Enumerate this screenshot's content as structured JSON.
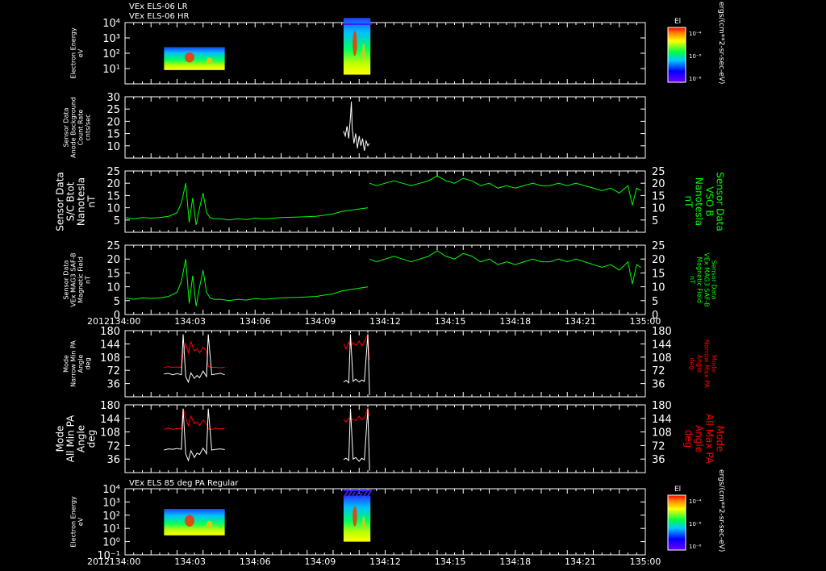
{
  "headers": {
    "top_line1": "VEx ELS-06 LR",
    "top_line2": "VEx ELS-06 HR",
    "bottom": "VEx ELS 85 deg PA Regular"
  },
  "time_axis": {
    "year": "2012",
    "ticks": [
      "134:00",
      "134:03",
      "134:06",
      "134:09",
      "134:12",
      "134:15",
      "134:18",
      "134:21",
      "135:00"
    ]
  },
  "colorbars": {
    "label": "El",
    "ticks": [
      "10⁻⁴",
      "10⁻⁶",
      "10⁻⁸"
    ],
    "unit": "ergs/(cm**2-sr-sec-eV)"
  },
  "colors": {
    "background": "#000000",
    "frame": "#ffffff",
    "white_trace": "#ffffff",
    "green_trace": "#00ff00",
    "red_trace": "#ff0000"
  },
  "chart_data": [
    {
      "type": "heatmap",
      "panel": "electron-energy-top",
      "ylabel": [
        "Electron Energy",
        "eV"
      ],
      "yscale": "log",
      "ylim": [
        1,
        10000
      ],
      "y_ticks": [
        "10⁴",
        "10³",
        "10²",
        "10¹"
      ],
      "x_range": [
        0,
        60
      ],
      "blocks": [
        {
          "x_start": 4.5,
          "x_end": 11.5,
          "y_low": 8,
          "y_high": 250
        },
        {
          "x_start": 25.2,
          "x_end": 28.3,
          "y_low": 4,
          "y_high": 20000
        }
      ]
    },
    {
      "type": "line",
      "panel": "anode-background",
      "ylabel": [
        "Sensor Data",
        "Anode Background",
        "Count Rate",
        "cnts/sec"
      ],
      "ylim": [
        5,
        30
      ],
      "y_ticks": [
        30,
        25,
        20,
        15,
        10
      ],
      "series": [
        {
          "color": "white",
          "x": [
            25.2,
            25.4,
            25.6,
            25.8,
            26.0,
            26.1,
            26.2,
            26.4,
            26.6,
            26.8,
            27.0,
            27.2,
            27.4,
            27.6,
            27.8,
            28.0,
            28.2
          ],
          "y": [
            16,
            14,
            18,
            13,
            22,
            28,
            17,
            11,
            15,
            9,
            14,
            10,
            13,
            8,
            12,
            10,
            11
          ]
        }
      ]
    },
    {
      "type": "line",
      "panel": "bmag-sc",
      "ylabel": [
        "Sensor Data",
        "S/C Btot",
        "Nanotesla",
        "nT"
      ],
      "ylabel_right": [
        "Sensor Data",
        "VSO B",
        "Nanotesla",
        "nT"
      ],
      "ylim": [
        0,
        25
      ],
      "y_ticks": [
        25,
        20,
        15,
        10,
        5
      ],
      "series": [
        {
          "color": "green",
          "x": [
            0,
            1,
            2,
            3,
            4,
            5,
            6,
            6.5,
            7,
            7.4,
            7.8,
            8.2,
            8.6,
            9,
            9.4,
            9.8,
            10.2,
            11,
            12,
            13,
            14,
            15,
            16,
            18,
            20,
            22,
            23,
            24,
            25,
            26,
            27,
            28
          ],
          "y": [
            6,
            5.5,
            6,
            5.8,
            6,
            6.5,
            8,
            12,
            20,
            4,
            14,
            3,
            10,
            16,
            8,
            6,
            5.5,
            5.5,
            5,
            5.5,
            5.2,
            5.8,
            5.5,
            6,
            6.2,
            6.5,
            7,
            7.5,
            8.5,
            9,
            9.5,
            10
          ]
        },
        {
          "color": "green",
          "x": [
            28.2,
            29,
            30,
            31,
            32,
            33,
            34,
            35,
            36,
            37,
            38,
            39,
            40,
            41,
            42,
            43,
            44,
            45,
            46,
            47,
            48,
            49,
            50,
            51,
            52,
            53,
            54,
            55,
            56,
            57,
            58,
            58.5,
            59,
            59.5
          ],
          "y": [
            20,
            19,
            20,
            21,
            20,
            19,
            20,
            21,
            23,
            21,
            20,
            22,
            21,
            19,
            20,
            18,
            19,
            18,
            19,
            20,
            19,
            19,
            20,
            19,
            20,
            19,
            18,
            17,
            18,
            16,
            19,
            11,
            18,
            17
          ]
        }
      ]
    },
    {
      "type": "line",
      "panel": "bmag-saf",
      "ylabel": [
        "Sensor Data",
        "VEx MAG3 SAF-B",
        "Magnetic Field",
        "nT"
      ],
      "ylabel_right": [
        "Sensor Data",
        "VEx MAG3 SAF-B",
        "Magnetic Field",
        "nT"
      ],
      "ylim": [
        0,
        25
      ],
      "y_ticks": [
        25,
        20,
        15,
        10,
        5,
        0
      ],
      "series": [
        {
          "color": "green",
          "x": [
            0,
            1,
            2,
            3,
            4,
            5,
            6,
            6.5,
            7,
            7.4,
            7.8,
            8.2,
            8.6,
            9,
            9.4,
            9.8,
            10.2,
            11,
            12,
            13,
            14,
            15,
            16,
            18,
            20,
            22,
            23,
            24,
            25,
            26,
            27,
            28
          ],
          "y": [
            6,
            5.5,
            6,
            5.8,
            6,
            6.5,
            8,
            12,
            20,
            4,
            14,
            3,
            10,
            16,
            8,
            6,
            5.5,
            5.5,
            5,
            5.5,
            5.2,
            5.8,
            5.5,
            6,
            6.2,
            6.5,
            7,
            7.5,
            8.5,
            9,
            9.5,
            10
          ]
        },
        {
          "color": "green",
          "x": [
            28.2,
            29,
            30,
            31,
            32,
            33,
            34,
            35,
            36,
            37,
            38,
            39,
            40,
            41,
            42,
            43,
            44,
            45,
            46,
            47,
            48,
            49,
            50,
            51,
            52,
            53,
            54,
            55,
            56,
            57,
            58,
            58.5,
            59,
            59.5
          ],
          "y": [
            20,
            19,
            20,
            21,
            20,
            19,
            20,
            21,
            23,
            21,
            20,
            22,
            21,
            19,
            20,
            18,
            19,
            18,
            19,
            20,
            19,
            19,
            20,
            19,
            20,
            19,
            18,
            17,
            18,
            16,
            19,
            11,
            18,
            17
          ]
        }
      ]
    },
    {
      "type": "line",
      "panel": "pa-narrow",
      "ylabel": [
        "Mode",
        "Narrow Min PA",
        "Angle",
        "deg"
      ],
      "ylabel_right": [
        "Mode",
        "Narrow Max PA",
        "Angle",
        "deg"
      ],
      "ylim": [
        0,
        180
      ],
      "y_ticks": [
        180,
        144,
        108,
        72,
        36
      ],
      "series": [
        {
          "color": "red",
          "x": [
            4.5,
            5,
            5.5,
            6,
            6.5,
            6.7,
            7,
            7.3,
            7.6,
            8,
            8.3,
            8.6,
            9,
            9.4,
            9.6,
            10,
            10.5,
            11,
            11.5
          ],
          "y": [
            80,
            82,
            80,
            81,
            80,
            118,
            145,
            120,
            150,
            125,
            130,
            120,
            135,
            125,
            82,
            80,
            80,
            79,
            80
          ]
        },
        {
          "color": "white",
          "x": [
            4.5,
            5,
            5.5,
            6,
            6.5,
            6.7,
            7,
            7.3,
            7.6,
            8,
            8.3,
            8.6,
            9,
            9.4,
            9.6,
            10,
            10.5,
            11,
            11.5
          ],
          "y": [
            62,
            64,
            60,
            63,
            60,
            170,
            55,
            40,
            65,
            50,
            58,
            52,
            70,
            55,
            170,
            60,
            62,
            64,
            60
          ]
        },
        {
          "color": "red",
          "x": [
            25.2,
            25.5,
            25.8,
            26,
            26.3,
            26.6,
            27,
            27.3,
            27.6,
            28,
            28.2
          ],
          "y": [
            145,
            130,
            150,
            135,
            148,
            140,
            152,
            138,
            150,
            170,
            100
          ]
        },
        {
          "color": "white",
          "x": [
            25.2,
            25.5,
            25.8,
            26,
            26.3,
            26.6,
            27,
            27.3,
            27.6,
            28,
            28.2
          ],
          "y": [
            40,
            45,
            38,
            170,
            42,
            48,
            40,
            46,
            42,
            170,
            5
          ]
        }
      ]
    },
    {
      "type": "line",
      "panel": "pa-all",
      "ylabel": [
        "Mode",
        "All Min PA",
        "Angle",
        "deg"
      ],
      "ylabel_right": [
        "Mode",
        "All Max PA",
        "Angle",
        "deg"
      ],
      "ylim": [
        0,
        180
      ],
      "y_ticks": [
        180,
        144,
        108,
        72,
        36
      ],
      "series": [
        {
          "color": "red",
          "x": [
            4.5,
            5,
            5.5,
            6,
            6.5,
            6.7,
            7,
            7.3,
            7.6,
            8,
            8.3,
            8.6,
            9,
            9.4,
            9.6,
            10,
            10.5,
            11,
            11.5
          ],
          "y": [
            115,
            118,
            115,
            117,
            116,
            170,
            145,
            125,
            150,
            130,
            135,
            125,
            140,
            130,
            116,
            115,
            118,
            116,
            117
          ]
        },
        {
          "color": "white",
          "x": [
            4.5,
            5,
            5.5,
            6,
            6.5,
            6.7,
            7,
            7.3,
            7.6,
            8,
            8.3,
            8.6,
            9,
            9.4,
            9.6,
            10,
            10.5,
            11,
            11.5
          ],
          "y": [
            60,
            63,
            62,
            64,
            62,
            170,
            50,
            32,
            58,
            40,
            52,
            48,
            65,
            50,
            170,
            60,
            62,
            63,
            61
          ]
        },
        {
          "color": "red",
          "x": [
            25.2,
            25.5,
            25.8,
            26,
            26.3,
            26.6,
            27,
            27.3,
            27.6,
            28,
            28.2
          ],
          "y": [
            140,
            135,
            145,
            140,
            142,
            138,
            150,
            140,
            145,
            170,
            150
          ]
        },
        {
          "color": "white",
          "x": [
            25.2,
            25.5,
            25.8,
            26,
            26.3,
            26.6,
            27,
            27.3,
            27.6,
            28,
            28.2
          ],
          "y": [
            35,
            38,
            32,
            170,
            36,
            40,
            30,
            38,
            34,
            170,
            5
          ]
        }
      ]
    },
    {
      "type": "heatmap",
      "panel": "electron-energy-bottom",
      "ylabel": [
        "Electron Energy",
        "eV"
      ],
      "yscale": "log",
      "ylim": [
        0.1,
        10000
      ],
      "y_ticks": [
        "10⁴",
        "10³",
        "10²",
        "10¹",
        "10⁰",
        "10⁻¹"
      ],
      "x_range": [
        0,
        60
      ],
      "blocks": [
        {
          "x_start": 4.5,
          "x_end": 11.5,
          "y_low": 3,
          "y_high": 300
        },
        {
          "x_start": 25.2,
          "x_end": 28.3,
          "y_low": 1,
          "y_high": 3000
        }
      ]
    }
  ]
}
